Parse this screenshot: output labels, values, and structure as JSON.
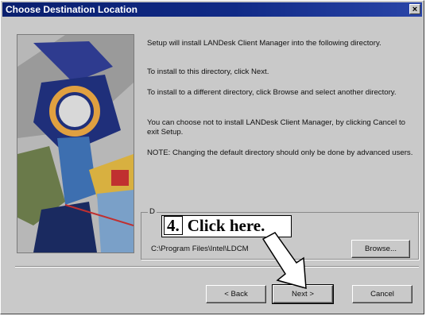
{
  "window": {
    "title": "Choose Destination Location",
    "close_glyph": "×"
  },
  "body": {
    "paragraphs": [
      "Setup will install LANDesk Client Manager into the following directory.",
      "To install to this directory, click Next.",
      "To install to a different directory, click Browse and select another directory.",
      "You can choose not to install LANDesk Client Manager, by clicking Cancel to exit Setup.",
      "NOTE:  Changing the default directory should only be done by advanced users."
    ]
  },
  "destination": {
    "group_label": "D",
    "path": "C:\\Program Files\\Intel\\LDCM"
  },
  "buttons": {
    "browse": "Browse...",
    "back": "< Back",
    "next": "Next >",
    "cancel": "Cancel"
  },
  "annotation": {
    "step_number": "4.",
    "text": "Click here."
  },
  "colors": {
    "titlebar": "#102a86",
    "dialog_face": "#c9c9c9"
  },
  "icons": {
    "close": "close-icon",
    "artwork": "setup-illustration",
    "arrow": "pointer-arrow-icon"
  }
}
